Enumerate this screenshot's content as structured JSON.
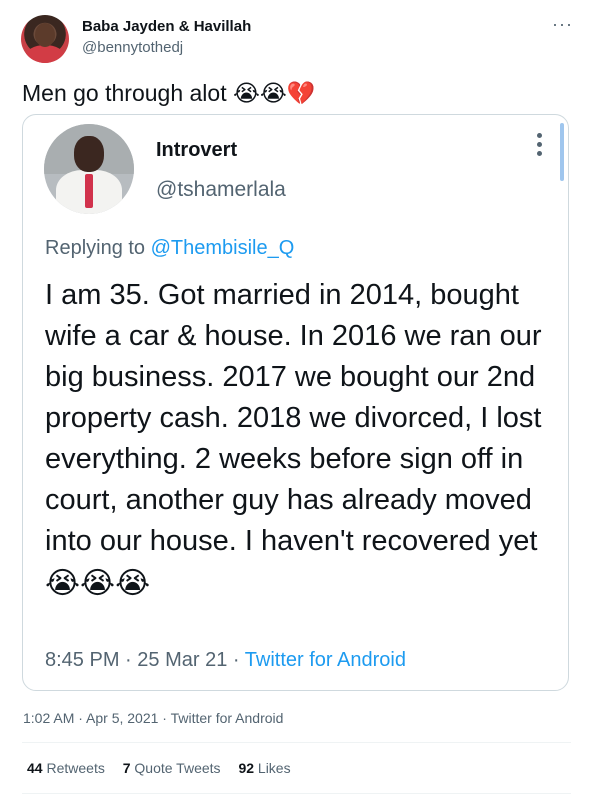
{
  "author": {
    "display_name": "Baba Jayden & Havillah",
    "handle": "@bennytothedj"
  },
  "more_menu_glyph": "···",
  "tweet": {
    "text": "Men go through alot",
    "emojis": "😭😭💔"
  },
  "quoted": {
    "display_name": "Introvert",
    "handle": "@tshamerlala",
    "replying_prefix": "Replying to",
    "replying_to": "@Thembisile_Q",
    "text": "I am 35. Got married in 2014, bought wife a car & house. In 2016 we ran our big business. 2017 we bought our 2nd property cash. 2018 we divorced, I lost everything. 2 weeks before sign off in court, another guy has already moved into our house. I haven't recovered yet",
    "emojis": "😭😭😭",
    "time": "8:45 PM",
    "date": "25 Mar 21",
    "separator": "·",
    "source": "Twitter for Android"
  },
  "meta": {
    "timestamp": "1:02 AM · Apr 5, 2021 · Twitter for Android"
  },
  "stats": {
    "retweets_count": "44",
    "retweets_label": "Retweets",
    "quotes_count": "7",
    "quotes_label": "Quote Tweets",
    "likes_count": "92",
    "likes_label": "Likes"
  },
  "colors": {
    "link_blue": "#1d9bf0",
    "secondary_text": "#536471",
    "border": "#cfd9de"
  }
}
